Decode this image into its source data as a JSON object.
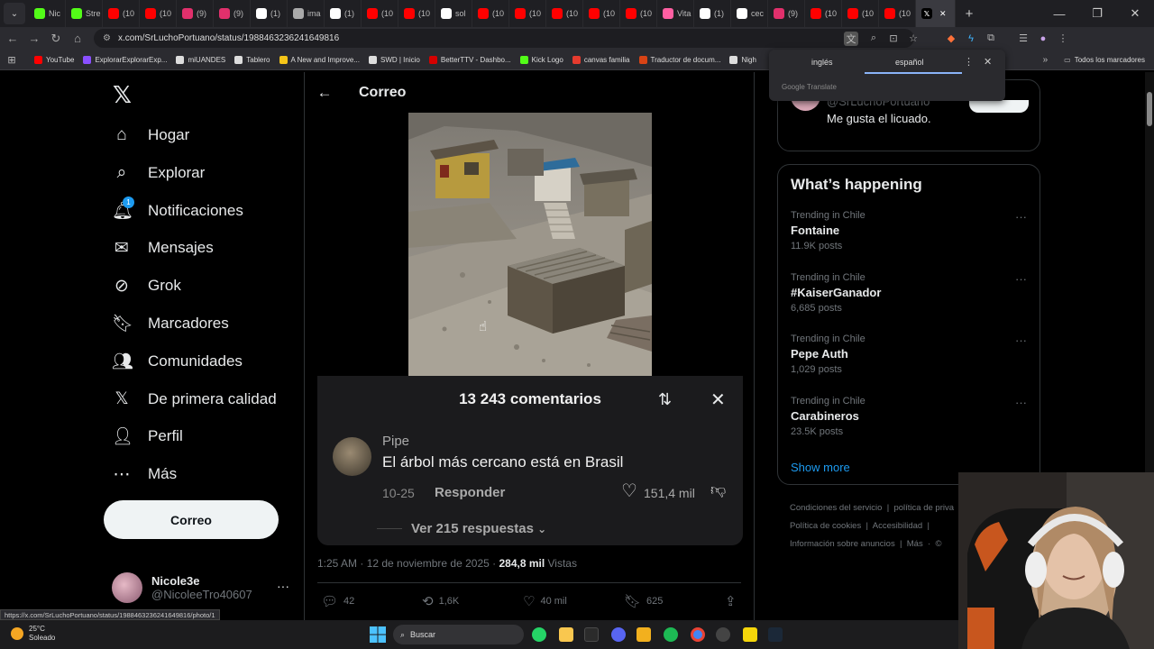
{
  "browser": {
    "tabs": [
      {
        "label": "Nic",
        "icon": "kick-icon",
        "color": "#53fc18"
      },
      {
        "label": "Stre",
        "icon": "kick-icon",
        "color": "#53fc18"
      },
      {
        "label": "(10",
        "icon": "youtube-icon",
        "color": "#ff0000"
      },
      {
        "label": "(10",
        "icon": "youtube-icon",
        "color": "#ff0000"
      },
      {
        "label": "(9)",
        "icon": "instagram-icon",
        "color": "#e1306c"
      },
      {
        "label": "(9)",
        "icon": "instagram-icon",
        "color": "#e1306c"
      },
      {
        "label": "(1)",
        "icon": "x-icon",
        "color": "#ffffff"
      },
      {
        "label": "ima",
        "icon": "globe-icon",
        "color": "#aaaaaa"
      },
      {
        "label": "(1)",
        "icon": "x-icon",
        "color": "#ffffff"
      },
      {
        "label": "(10",
        "icon": "youtube-icon",
        "color": "#ff0000"
      },
      {
        "label": "(10",
        "icon": "youtube-icon",
        "color": "#ff0000"
      },
      {
        "label": "sol",
        "icon": "google-icon",
        "color": "#ffffff"
      },
      {
        "label": "(10",
        "icon": "youtube-icon",
        "color": "#ff0000"
      },
      {
        "label": "(10",
        "icon": "youtube-icon",
        "color": "#ff0000"
      },
      {
        "label": "(10",
        "icon": "youtube-icon",
        "color": "#ff0000"
      },
      {
        "label": "(10",
        "icon": "youtube-icon",
        "color": "#ff0000"
      },
      {
        "label": "(10",
        "icon": "youtube-icon",
        "color": "#ff0000"
      },
      {
        "label": "Vita",
        "icon": "vita-icon",
        "color": "#ff5fa2"
      },
      {
        "label": "(1)",
        "icon": "x-icon",
        "color": "#ffffff"
      },
      {
        "label": "cec",
        "icon": "google-icon",
        "color": "#ffffff"
      },
      {
        "label": "(9)",
        "icon": "instagram-icon",
        "color": "#e1306c"
      },
      {
        "label": "(10",
        "icon": "youtube-icon",
        "color": "#ff0000"
      },
      {
        "label": "(10",
        "icon": "youtube-icon",
        "color": "#ff0000"
      },
      {
        "label": "(10",
        "icon": "youtube-icon",
        "color": "#ff0000"
      }
    ],
    "active_tab_close": "✕",
    "new_tab": "+",
    "url": "x.com/SrLuchoPortuano/status/1988463236241649816",
    "bookmarks": [
      {
        "label": "YouTube",
        "color": "#ff0000"
      },
      {
        "label": "ExplorarExplorarExp...",
        "color": "#8a4fff"
      },
      {
        "label": "miUANDES",
        "color": "#dddddd"
      },
      {
        "label": "Tablero",
        "color": "#dddddd"
      },
      {
        "label": "A New and Improve...",
        "color": "#f5c518"
      },
      {
        "label": "SWD | Inicio",
        "color": "#dddddd"
      },
      {
        "label": "BetterTTV - Dashbo...",
        "color": "#d50000"
      },
      {
        "label": "Kick Logo",
        "color": "#53fc18"
      },
      {
        "label": "canvas familia",
        "color": "#e63b2e"
      },
      {
        "label": "Traductor de docum...",
        "color": "#d84315"
      },
      {
        "label": "Nigh",
        "color": "#dddddd"
      }
    ],
    "all_bookmarks": "Todos los marcadores",
    "status_url": "https://x.com/SrLuchoPortuano/status/1988463236241649816/photo/1"
  },
  "translate_popup": {
    "lang_from": "inglés",
    "lang_to": "español",
    "brand": "Google Translate"
  },
  "sidebar": {
    "items": [
      {
        "label": "Hogar",
        "icon": "home-icon"
      },
      {
        "label": "Explorar",
        "icon": "search-icon"
      },
      {
        "label": "Notificaciones",
        "icon": "bell-icon",
        "badge": "1"
      },
      {
        "label": "Mensajes",
        "icon": "mail-icon"
      },
      {
        "label": "Grok",
        "icon": "grok-icon"
      },
      {
        "label": "Marcadores",
        "icon": "bookmark-icon"
      },
      {
        "label": "Comunidades",
        "icon": "communities-icon"
      },
      {
        "label": "De primera calidad",
        "icon": "x-premium-icon"
      },
      {
        "label": "Perfil",
        "icon": "person-icon"
      },
      {
        "label": "Más",
        "icon": "more-circle-icon"
      }
    ],
    "post_button": "Correo",
    "account": {
      "name": "Nicole3e",
      "handle": "@NicoleeTro40607",
      "more": "···"
    }
  },
  "main": {
    "header_title": "Correo",
    "comments_overlay": {
      "title": "13 243 comentarios",
      "comment": {
        "author": "Pipe",
        "text": "El árbol más cercano está en Brasil",
        "date": "10-25",
        "reply_label": "Responder",
        "likes": "151,4 mil"
      },
      "view_replies": "Ver 215 respuestas"
    },
    "meta": {
      "time_date": "1:25 AM · 12 de noviembre de 2025 · ",
      "views_count": "284,8 mil",
      "views_label": " Vistas"
    },
    "actions": {
      "replies": "42",
      "reposts": "1,6K",
      "likes": "40 mil",
      "bookmarks": "625"
    }
  },
  "right": {
    "who_to_follow": {
      "handle": "@SrLuchoPortuano",
      "bio": "Me gusta el licuado."
    },
    "trends_title": "What’s happening",
    "trends": [
      {
        "context": "Trending in Chile",
        "name": "Fontaine",
        "posts": "11.9K posts"
      },
      {
        "context": "Trending in Chile",
        "name": "#KaiserGanador",
        "posts": "6,685 posts"
      },
      {
        "context": "Trending in Chile",
        "name": "Pepe Auth",
        "posts": "1,029 posts"
      },
      {
        "context": "Trending in Chile",
        "name": "Carabineros",
        "posts": "23.5K posts"
      }
    ],
    "show_more": "Show more",
    "footer": {
      "line1a": "Condiciones del servicio",
      "line1b": "política de priva",
      "line2a": "Política de cookies",
      "line2b": "Accesibilidad",
      "line3a": "Información sobre anuncios",
      "line3b": "Más",
      "line3c": "©"
    }
  },
  "taskbar": {
    "temp": "25°C",
    "weather": "Soleado",
    "search": "Buscar"
  }
}
